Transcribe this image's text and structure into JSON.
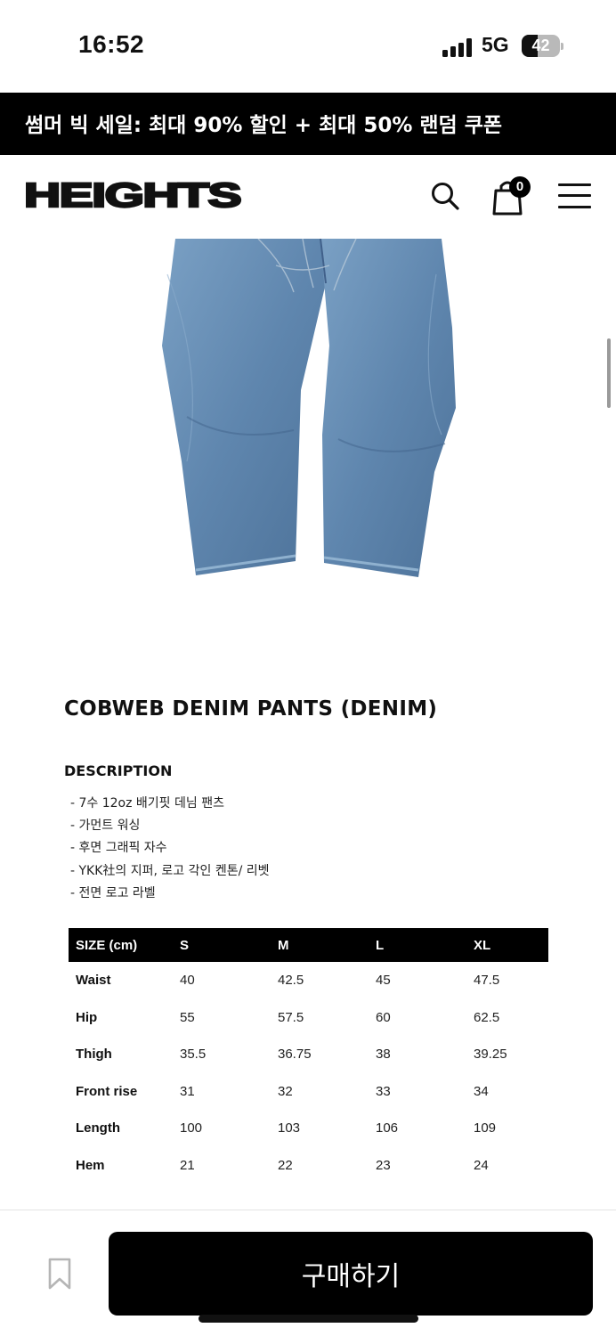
{
  "status_bar": {
    "time": "16:52",
    "network": "5G",
    "battery_level": "42",
    "battery_fraction": 0.42,
    "signal_icon": "cellular-signal-icon"
  },
  "promo_banner": {
    "text": "썸머 빅 세일: 최대 90% 할인 + 최대 50% 랜덤 쿠폰"
  },
  "header": {
    "logo": "HEIGHTS",
    "search_icon": "search-icon",
    "cart_icon": "shopping-bag-icon",
    "cart_count": "0",
    "menu_icon": "hamburger-menu-icon"
  },
  "product": {
    "image_alt": "denim-pants-back-view",
    "title": "COBWEB DENIM PANTS (DENIM)",
    "description_heading": "DESCRIPTION",
    "description_items": [
      "- 7수 12oz 배기핏 데님 팬츠",
      "- 가먼트 워싱",
      "- 후면 그래픽 자수",
      "- YKK社의 지퍼, 로고 각인 켄톤/ 리벳",
      "- 전면 로고 라벨"
    ]
  },
  "size_table": {
    "headers": [
      "SIZE (cm)",
      "S",
      "M",
      "L",
      "XL"
    ],
    "rows": [
      {
        "label": "Waist",
        "values": [
          "40",
          "42.5",
          "45",
          "47.5"
        ]
      },
      {
        "label": "Hip",
        "values": [
          "55",
          "57.5",
          "60",
          "62.5"
        ]
      },
      {
        "label": "Thigh",
        "values": [
          "35.5",
          "36.75",
          "38",
          "39.25"
        ]
      },
      {
        "label": "Front rise",
        "values": [
          "31",
          "32",
          "33",
          "34"
        ]
      },
      {
        "label": "Length",
        "values": [
          "100",
          "103",
          "106",
          "109"
        ]
      },
      {
        "label": "Hem",
        "values": [
          "21",
          "22",
          "23",
          "24"
        ]
      }
    ]
  },
  "bottom_bar": {
    "bookmark_icon": "bookmark-icon",
    "buy_label": "구매하기"
  },
  "colors": {
    "background": "#ffffff",
    "banner": "#000000",
    "denim_light": "#6f93b8",
    "denim_dark": "#4a6d94"
  }
}
